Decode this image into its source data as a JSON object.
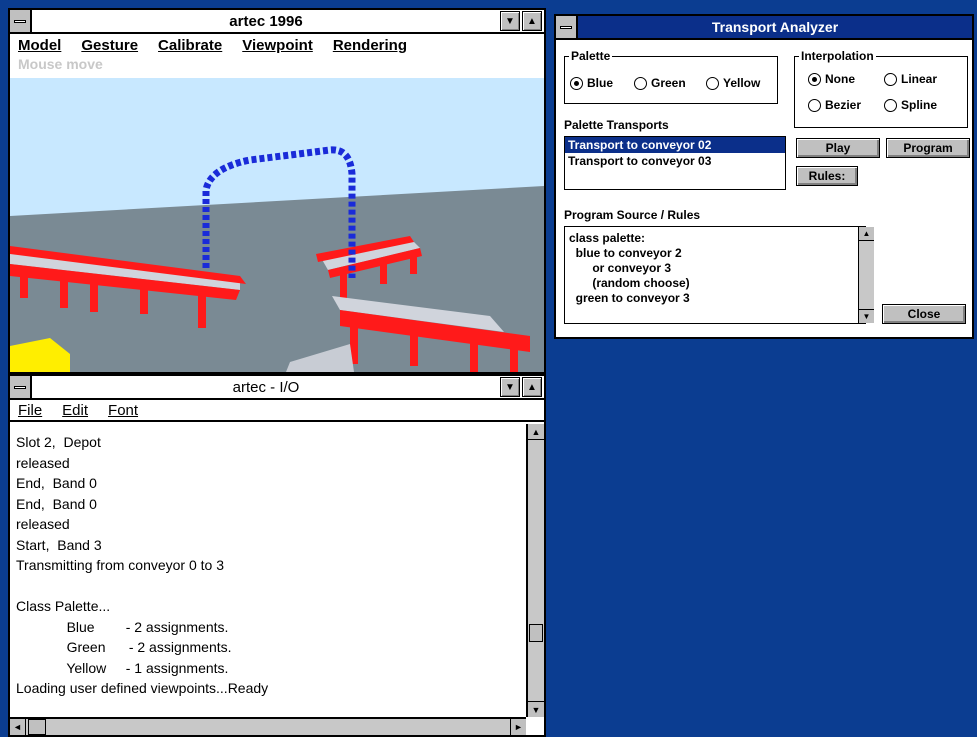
{
  "win3d": {
    "title": "artec 1996",
    "menu": [
      "Model",
      "Gesture",
      "Calibrate",
      "Viewpoint",
      "Rendering"
    ],
    "status": "Mouse move"
  },
  "io": {
    "title": "artec - I/O",
    "menu": [
      "File",
      "Edit",
      "Font"
    ],
    "lines": [
      "Slot 2,  Depot",
      "released",
      "End,  Band 0",
      "End,  Band 0",
      "released",
      "Start,  Band 3",
      "Transmitting from conveyor 0 to 3",
      "",
      "Class Palette...",
      "             Blue        - 2 assignments.",
      "             Green      - 2 assignments.",
      "             Yellow     - 1 assignments.",
      "Loading user defined viewpoints...Ready"
    ]
  },
  "dialog": {
    "title": "Transport Analyzer",
    "palette_legend": "Palette",
    "palette_options": [
      "Blue",
      "Green",
      "Yellow"
    ],
    "palette_selected": "Blue",
    "interp_legend": "Interpolation",
    "interp_options": [
      "None",
      "Linear",
      "Bezier",
      "Spline"
    ],
    "interp_selected": "None",
    "transports_label": "Palette Transports",
    "transports": [
      "Transport to conveyor 02",
      "Transport to conveyor 03"
    ],
    "transports_selected": 0,
    "play_label": "Play",
    "program_label": "Program",
    "rules_label": "Rules:",
    "source_label": "Program Source / Rules",
    "source_lines": [
      "class palette:",
      "  blue to conveyor 2",
      "       or conveyor 3",
      "       (random choose)",
      "  green to conveyor 3"
    ],
    "close_label": "Close"
  },
  "colors": {
    "desktop": "#0b3d91",
    "dialog_title": "#0b2f8a",
    "conveyor": "#ff1a1a",
    "path": "#1a2bd9",
    "floor": "#7a8a94",
    "sky": "#c8e8ff"
  },
  "icons": [
    "system-menu-icon",
    "minimize-icon",
    "maximize-icon",
    "scroll-up-icon",
    "scroll-down-icon",
    "scroll-left-icon",
    "scroll-right-icon"
  ]
}
